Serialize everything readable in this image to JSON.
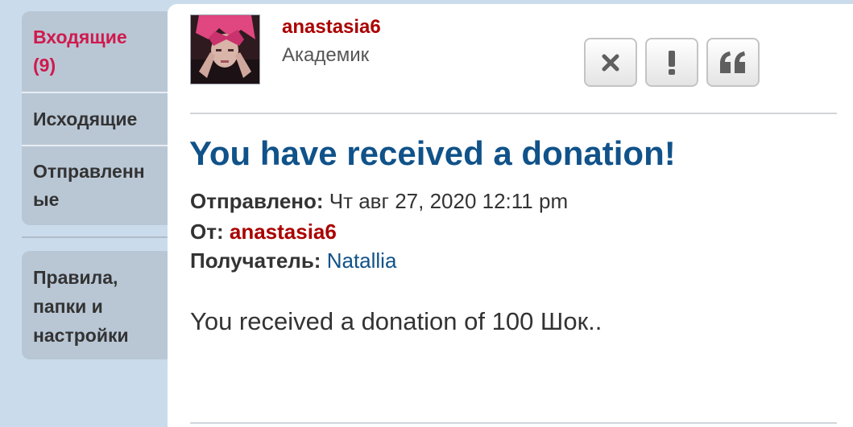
{
  "sidebar": {
    "inbox_line1": "Входящие",
    "inbox_line2": "(9)",
    "outbox": "Исходящие",
    "sent_line1": "Отправленн",
    "sent_line2": "ые",
    "rules_line1": "Правила,",
    "rules_line2": "папки и",
    "rules_line3": "настройки"
  },
  "message": {
    "author": "anastasia6",
    "author_rank": "Академик",
    "subject": "You have received a donation!",
    "sent_label": "Отправлено:",
    "sent_value": "Чт авг 27, 2020 12:11 pm",
    "from_label": "От:",
    "from_value": "anastasia6",
    "to_label": "Получатель:",
    "to_value": "Natallia",
    "body": "You received a donation of 100 Шок.."
  },
  "actions": {
    "delete_icon": "close-icon",
    "report_icon": "exclamation-icon",
    "quote_icon": "quote-icon"
  },
  "colors": {
    "page_background": "#cadcec",
    "active_nav": "#d0194d",
    "author_link": "#aa0000",
    "subject": "#105289",
    "recipient_link": "#105289"
  }
}
